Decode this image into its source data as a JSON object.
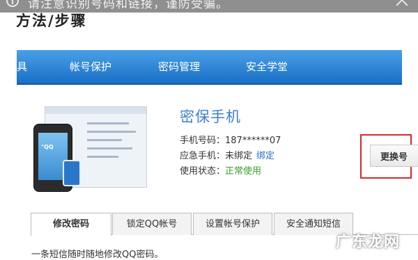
{
  "banner": {
    "text": "请注意识别号码和链接，谨防受骗。"
  },
  "step_title": "方法/步骤",
  "nav": {
    "items": [
      "具",
      "帐号保护",
      "密码管理",
      "安全学堂"
    ]
  },
  "illustration": {
    "phone_text": "\"QQ"
  },
  "card": {
    "title": "密保手机",
    "rows": [
      {
        "label": "手机号码：",
        "value": "187******07"
      },
      {
        "label": "应急手机：",
        "value": "未绑定",
        "link": "绑定"
      },
      {
        "label": "使用状态：",
        "value": "正常使用"
      }
    ],
    "change_button": "更换号"
  },
  "tabs": [
    "修改密码",
    "锁定QQ帐号",
    "设置帐号保护",
    "安全通知短信"
  ],
  "description": "一条短信随时随地修改QQ密码。",
  "watermark": "广东龙网",
  "colors": {
    "nav_blue": "#1a6fc6",
    "title_blue": "#3b7fcf",
    "status_green": "#3aa02a",
    "highlight_red": "#d42a2a"
  }
}
